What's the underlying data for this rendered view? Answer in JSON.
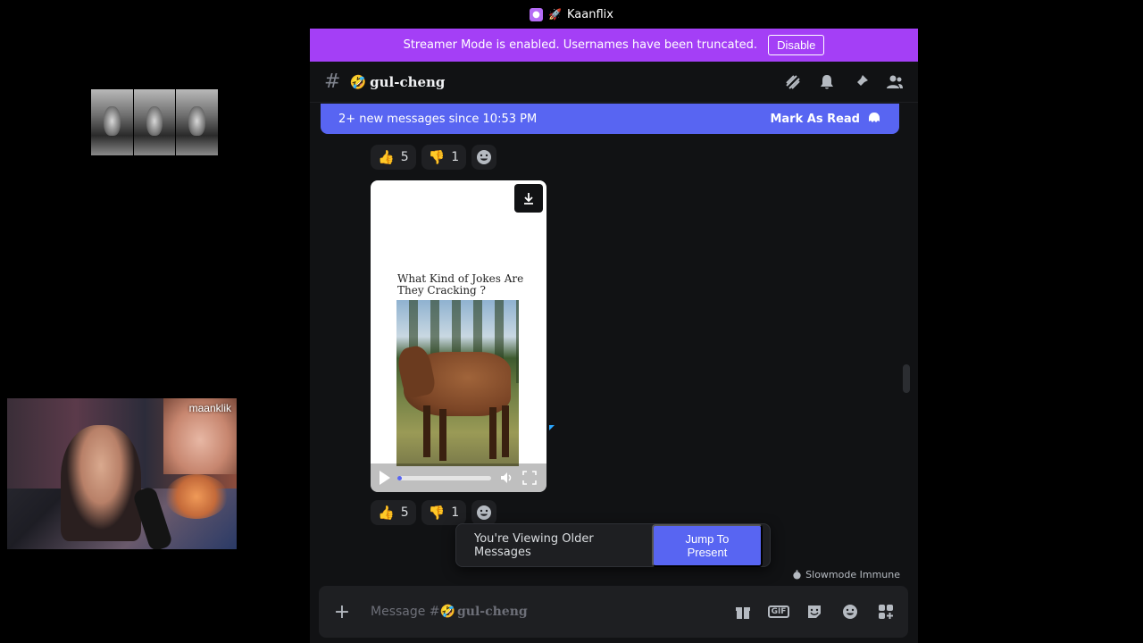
{
  "window": {
    "title": "Kaanflix"
  },
  "overlay": {
    "webcam_label": "maanklik"
  },
  "streamer_banner": {
    "text": "Streamer Mode is enabled. Usernames have been truncated.",
    "disable_label": "Disable"
  },
  "channel": {
    "emoji": "🤣",
    "name": "gul-cheng"
  },
  "new_messages_bar": {
    "text": "2+ new messages since 10:53 PM",
    "mark_as_read": "Mark As Read"
  },
  "reactions_top": [
    {
      "icon": "thumbs-up-icon",
      "glyph": "👍",
      "count": "5"
    },
    {
      "icon": "thumbs-down-icon",
      "glyph": "👎",
      "count": "1"
    }
  ],
  "reactions_bottom": [
    {
      "icon": "thumbs-up-icon",
      "glyph": "👍",
      "count": "5"
    },
    {
      "icon": "thumbs-down-icon",
      "glyph": "👎",
      "count": "1"
    }
  ],
  "video": {
    "caption": "What Kind of Jokes Are They Cracking ?",
    "progress": 0.05
  },
  "older_messages_toast": {
    "text": "You're Viewing Older Messages",
    "jump_label": "Jump To Present"
  },
  "slowmode": {
    "text": "Slowmode Immune"
  },
  "composer": {
    "placeholder_prefix": "Message #",
    "channel_emoji": "🤣",
    "channel_name": "gul-cheng",
    "gif_label": "GIF"
  },
  "colors": {
    "streamer_banner": "#a43ff6",
    "blurple": "#5865f2",
    "background": "#111214"
  }
}
